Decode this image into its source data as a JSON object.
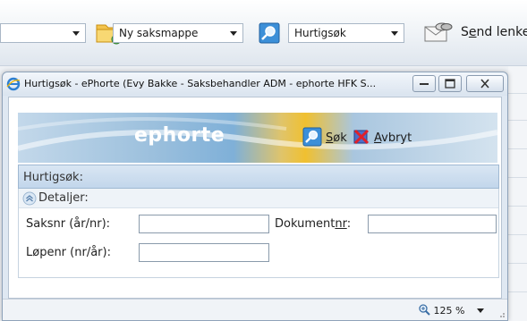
{
  "toolbar": {
    "ny_saksmappe": "Ny saksmappe",
    "hurtigsok": "Hurtigsøk",
    "send_lenke_pre": "S",
    "send_lenke_key": "e",
    "send_lenke_post": "nd lenke"
  },
  "popup": {
    "title": "Hurtigsøk - ePhorte (Evy Bakke - Saksbehandler ADM - ephorte HFK S...",
    "logo": "ephorte",
    "sok_key": "S",
    "sok_rest": "øk",
    "avbryt_key": "A",
    "avbryt_rest": "vbryt",
    "section_title": "Hurtigsøk:",
    "details_title": "Detaljer:",
    "saksnr_label": "Saksnr (år/nr):",
    "dokumentnr_pre": "Dokument",
    "dokumentnr_key": "nr",
    "dokumentnr_post": ":",
    "lopenr_label": "Løpenr (nr/år):",
    "saksnr_value": "",
    "dokumentnr_value": "",
    "lopenr_value": "",
    "zoom": "125 %"
  },
  "colors": {
    "accent": "#3c78c8",
    "section_bg": "#c9dcee",
    "logo_gold": "#f0c030"
  }
}
